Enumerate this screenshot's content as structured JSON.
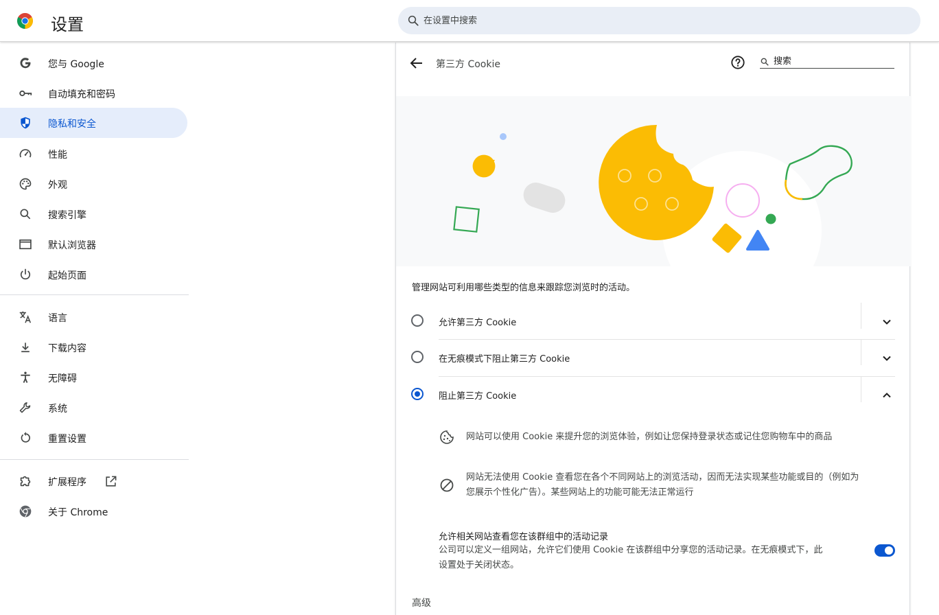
{
  "header": {
    "app_title": "设置",
    "search_placeholder": "在设置中搜索"
  },
  "sidebar": {
    "items": [
      {
        "label": "您与 Google",
        "icon": "google-icon"
      },
      {
        "label": "自动填充和密码",
        "icon": "key-icon"
      },
      {
        "label": "隐私和安全",
        "icon": "shield-icon",
        "active": true
      },
      {
        "label": "性能",
        "icon": "speedometer-icon"
      },
      {
        "label": "外观",
        "icon": "palette-icon"
      },
      {
        "label": "搜索引擎",
        "icon": "search-icon"
      },
      {
        "label": "默认浏览器",
        "icon": "browser-window-icon"
      },
      {
        "label": "起始页面",
        "icon": "power-icon"
      },
      {
        "label": "语言",
        "icon": "translate-icon"
      },
      {
        "label": "下载内容",
        "icon": "download-icon"
      },
      {
        "label": "无障碍",
        "icon": "accessibility-icon"
      },
      {
        "label": "系统",
        "icon": "wrench-icon"
      },
      {
        "label": "重置设置",
        "icon": "reset-icon"
      },
      {
        "label": "扩展程序",
        "icon": "puzzle-icon"
      },
      {
        "label": "关于 Chrome",
        "icon": "chrome-icon"
      }
    ]
  },
  "page": {
    "title": "第三方 Cookie",
    "search_placeholder": "搜索",
    "description": "管理网站可利用哪些类型的信息来跟踪您浏览时的活动。",
    "options": [
      {
        "label": "允许第三方 Cookie",
        "selected": false,
        "expanded": false
      },
      {
        "label": "在无痕模式下阻止第三方 Cookie",
        "selected": false,
        "expanded": false
      },
      {
        "label": "阻止第三方 Cookie",
        "selected": true,
        "expanded": true
      }
    ],
    "details": [
      {
        "icon": "cookie-icon",
        "text": "网站可以使用 Cookie 来提升您的浏览体验，例如让您保持登录状态或记住您购物车中的商品"
      },
      {
        "icon": "block-icon",
        "text_line1": "网站无法使用 Cookie 查看您在各个不同网站上的浏览活动，因而无法实现某些功能或目的（例如为",
        "text_line2": "您展示个性化广告）。某些网站上的功能可能无法正常运行"
      }
    ],
    "related_sites": {
      "title": "允许相关网站查看您在该群组中的活动记录",
      "desc_line1": "公司可以定义一组网站，允许它们使用 Cookie 在该群组中分享您的活动记录。在无痕模式下，此",
      "desc_line2": "设置处于关闭状态。",
      "enabled": true
    },
    "advanced_label": "高级"
  },
  "colors": {
    "accent": "#0b57d0",
    "active_nav_bg": "#e5edfb",
    "search_bg": "#e9eef6",
    "cookie_yellow": "#fbbc04"
  }
}
